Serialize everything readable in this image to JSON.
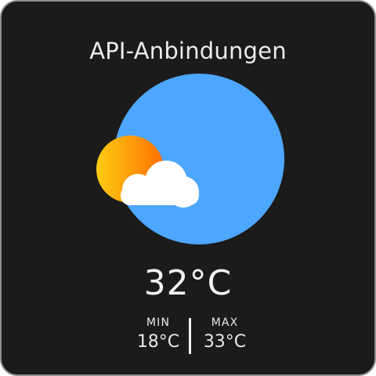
{
  "app": {
    "title": "API-Anbindungen"
  },
  "weather": {
    "icon": "partly-cloudy-icon",
    "current_temp": "32°C",
    "min_label": "MIN",
    "min_value": "18°C",
    "max_label": "MAX",
    "max_value": "33°C"
  },
  "colors": {
    "background": "#1b1b1b",
    "circle": "#4da6ff",
    "sun_light": "#ffc81a",
    "sun_dark": "#ff7a00",
    "cloud": "#ffffff",
    "text": "#f4f4f4"
  }
}
